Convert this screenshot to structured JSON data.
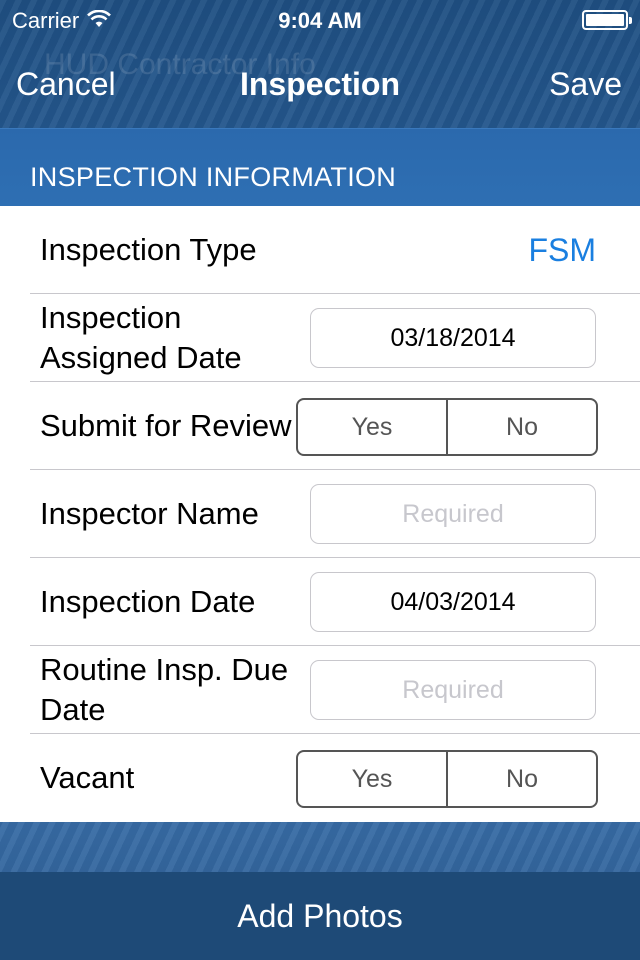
{
  "status_bar": {
    "carrier": "Carrier",
    "time": "9:04 AM"
  },
  "nav": {
    "background_title": "HUD Contractor Info",
    "cancel": "Cancel",
    "title": "Inspection",
    "save": "Save"
  },
  "section": {
    "header": "INSPECTION INFORMATION"
  },
  "rows": {
    "inspection_type": {
      "label": "Inspection Type",
      "value": "FSM"
    },
    "assigned_date": {
      "label": "Inspection Assigned Date",
      "value": "03/18/2014"
    },
    "submit_review": {
      "label": "Submit for Review",
      "yes": "Yes",
      "no": "No"
    },
    "inspector_name": {
      "label": "Inspector Name",
      "placeholder": "Required"
    },
    "inspection_date": {
      "label": "Inspection Date",
      "value": "04/03/2014"
    },
    "routine_due": {
      "label": "Routine Insp. Due Date",
      "placeholder": "Required"
    },
    "vacant": {
      "label": "Vacant",
      "yes": "Yes",
      "no": "No"
    }
  },
  "footer": {
    "add_photos": "Add Photos"
  },
  "colors": {
    "nav_background": "#1f4f82",
    "section_header": "#2e6fb3",
    "accent_value": "#1a7fe0",
    "footer": "#1e4a77"
  },
  "icons": [
    "wifi-icon",
    "battery-icon"
  ]
}
